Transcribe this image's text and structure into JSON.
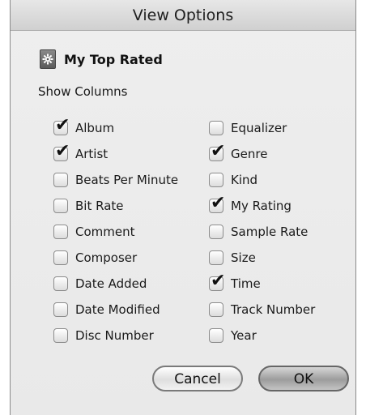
{
  "dialog": {
    "title": "View Options",
    "playlist": {
      "icon": "gear-icon",
      "name": "My Top Rated"
    },
    "section_label": "Show Columns",
    "columns_left": [
      {
        "label": "Album",
        "checked": true
      },
      {
        "label": "Artist",
        "checked": true
      },
      {
        "label": "Beats Per Minute",
        "checked": false
      },
      {
        "label": "Bit Rate",
        "checked": false
      },
      {
        "label": "Comment",
        "checked": false
      },
      {
        "label": "Composer",
        "checked": false
      },
      {
        "label": "Date Added",
        "checked": false
      },
      {
        "label": "Date Modified",
        "checked": false
      },
      {
        "label": "Disc Number",
        "checked": false
      }
    ],
    "columns_right": [
      {
        "label": "Equalizer",
        "checked": false
      },
      {
        "label": "Genre",
        "checked": true
      },
      {
        "label": "Kind",
        "checked": false
      },
      {
        "label": "My Rating",
        "checked": true
      },
      {
        "label": "Sample Rate",
        "checked": false
      },
      {
        "label": "Size",
        "checked": false
      },
      {
        "label": "Time",
        "checked": true
      },
      {
        "label": "Track Number",
        "checked": false
      },
      {
        "label": "Year",
        "checked": false
      }
    ],
    "buttons": {
      "cancel": "Cancel",
      "ok": "OK"
    }
  }
}
